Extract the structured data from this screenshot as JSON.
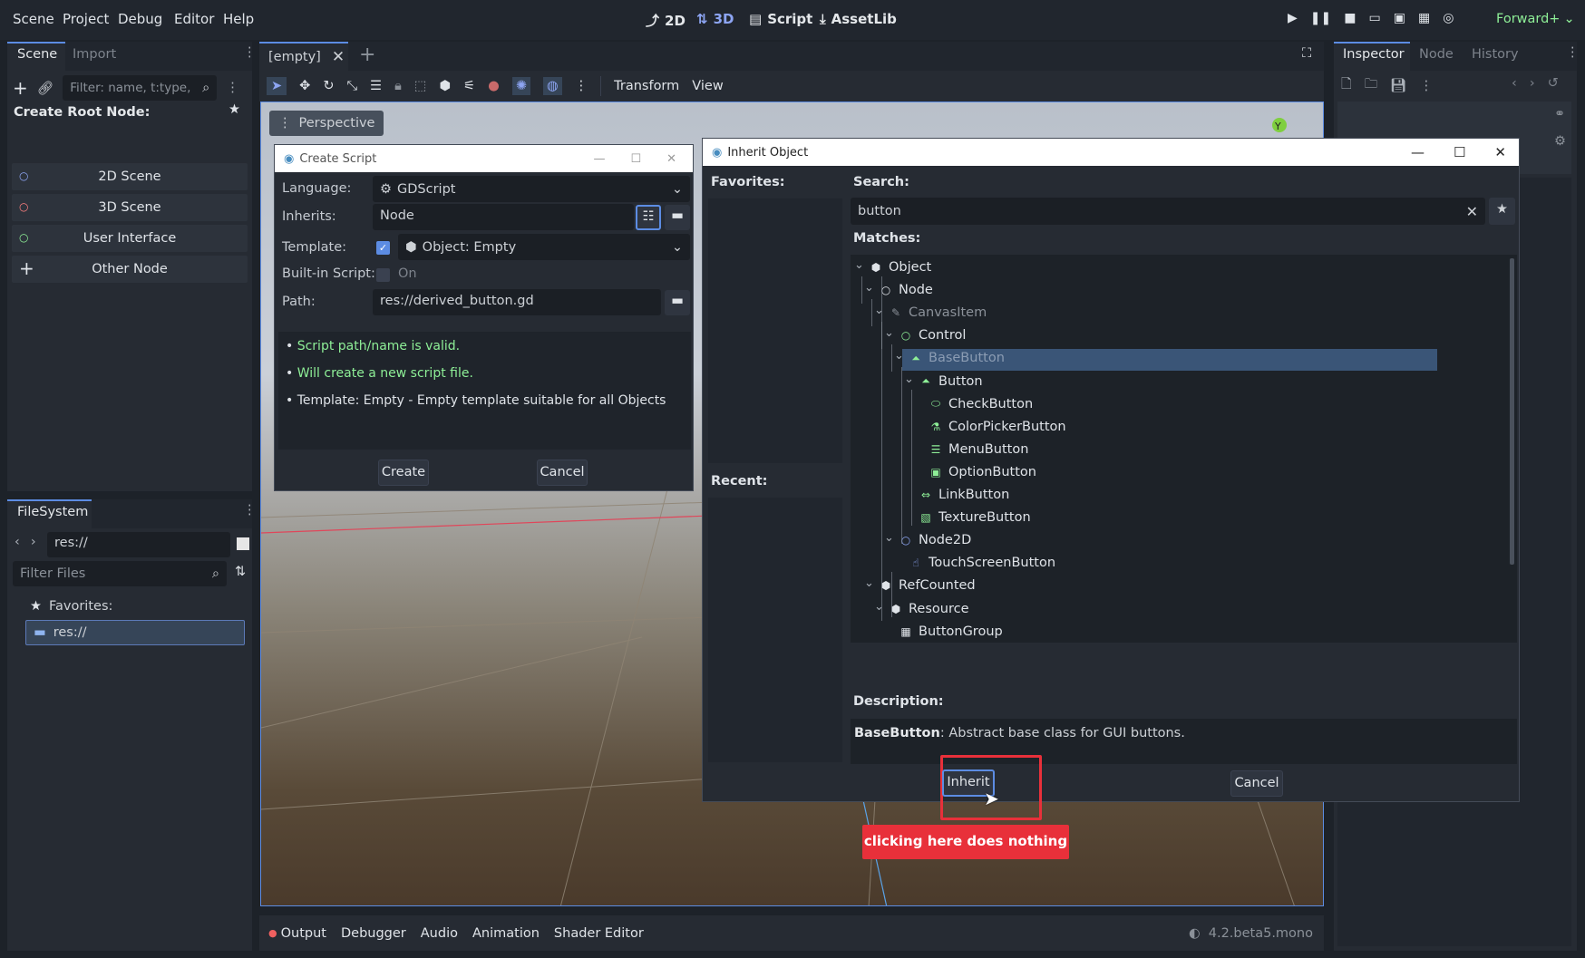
{
  "menu": {
    "items": [
      "Scene",
      "Project",
      "Debug",
      "Editor",
      "Help"
    ]
  },
  "workspaces": {
    "w2d": "2D",
    "w3d": "3D",
    "script": "Script",
    "assetlib": "AssetLib"
  },
  "renderer": "Forward+",
  "scene_dock": {
    "tab_scene": "Scene",
    "tab_import": "Import",
    "filter_placeholder": "Filter: name, t:type,",
    "create_root": "Create Root Node:",
    "items": [
      {
        "label": "2D Scene",
        "color": "#8da5f3"
      },
      {
        "label": "3D Scene",
        "color": "#fc7f7f"
      },
      {
        "label": "User Interface",
        "color": "#8eef97"
      },
      {
        "label": "Other Node",
        "color": "#dfe3e8"
      }
    ]
  },
  "filesystem": {
    "title": "FileSystem",
    "path": "res://",
    "filter_placeholder": "Filter Files",
    "favorites": "Favorites:",
    "root": "res://"
  },
  "editor": {
    "tab": "[empty]",
    "transform": "Transform",
    "view": "View",
    "perspective": "Perspective",
    "gizmo_y": "Y"
  },
  "bottom": {
    "output": "Output",
    "debugger": "Debugger",
    "audio": "Audio",
    "animation": "Animation",
    "shader_editor": "Shader Editor",
    "version": "4.2.beta5.mono"
  },
  "inspector": {
    "tab_inspector": "Inspector",
    "tab_node": "Node",
    "tab_history": "History"
  },
  "create_script": {
    "title": "Create Script",
    "language_label": "Language:",
    "language_value": "GDScript",
    "inherits_label": "Inherits:",
    "inherits_value": "Node",
    "template_label": "Template:",
    "template_value": "Object: Empty",
    "builtin_label": "Built-in Script:",
    "builtin_value": "On",
    "path_label": "Path:",
    "path_value": "res://derived_button.gd",
    "messages": [
      {
        "text": "Script path/name is valid.",
        "color": "#8eef97"
      },
      {
        "text": "Will create a new script file.",
        "color": "#8eef97"
      },
      {
        "text": "Template: Empty - Empty template suitable for all Objects",
        "color": "#dfe3e8"
      }
    ],
    "create": "Create",
    "cancel": "Cancel"
  },
  "inherit": {
    "title": "Inherit Object",
    "favorites": "Favorites:",
    "recent": "Recent:",
    "search_label": "Search:",
    "search_value": "button",
    "matches": "Matches:",
    "tree": [
      "Object",
      "Node",
      "CanvasItem",
      "Control",
      "BaseButton",
      "Button",
      "CheckButton",
      "ColorPickerButton",
      "MenuButton",
      "OptionButton",
      "LinkButton",
      "TextureButton",
      "Node2D",
      "TouchScreenButton",
      "RefCounted",
      "Resource",
      "ButtonGroup"
    ],
    "description_label": "Description:",
    "description_class": "BaseButton",
    "description_text": ": Abstract base class for GUI buttons.",
    "inherit_button": "Inherit",
    "cancel": "Cancel"
  },
  "annotation": {
    "text": "clicking here does nothing",
    "color": "#e8303a"
  }
}
